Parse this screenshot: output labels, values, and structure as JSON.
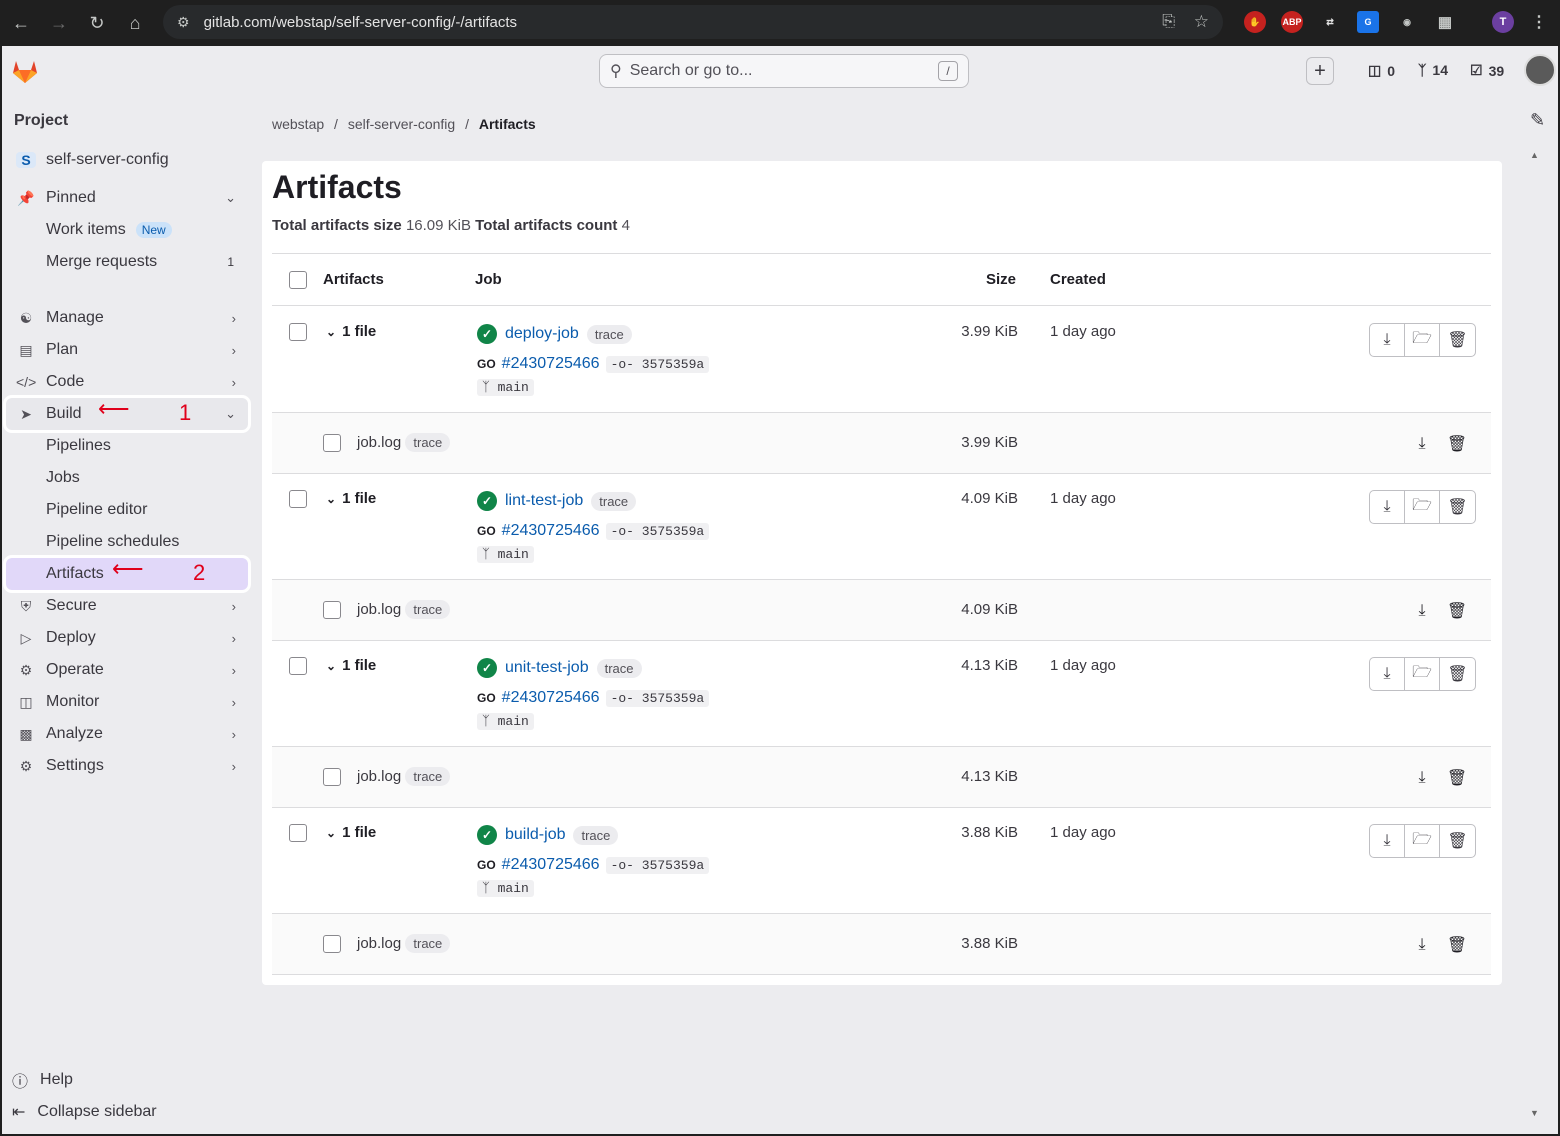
{
  "browser": {
    "url": "gitlab.com/webstap/self-server-config/-/artifacts",
    "profile_initial": "T",
    "ext_abp": "ABP"
  },
  "topbar": {
    "search_placeholder": "Search or go to...",
    "search_shortcut": "/",
    "issues_count": "0",
    "mr_count": "14",
    "todo_count": "39"
  },
  "sidebar": {
    "heading": "Project",
    "project_initial": "S",
    "project_name": "self-server-config",
    "pinned": "Pinned",
    "work_items": "Work items",
    "new_badge": "New",
    "merge_requests": "Merge requests",
    "merge_requests_count": "1",
    "manage": "Manage",
    "plan": "Plan",
    "code": "Code",
    "build": "Build",
    "pipelines": "Pipelines",
    "jobs": "Jobs",
    "pipeline_editor": "Pipeline editor",
    "pipeline_schedules": "Pipeline schedules",
    "artifacts": "Artifacts",
    "secure": "Secure",
    "deploy": "Deploy",
    "operate": "Operate",
    "monitor": "Monitor",
    "analyze": "Analyze",
    "settings": "Settings",
    "help": "Help",
    "collapse": "Collapse sidebar"
  },
  "annotations": {
    "step1": "1",
    "step2": "2"
  },
  "breadcrumb": [
    "webstap",
    "self-server-config",
    "Artifacts"
  ],
  "page": {
    "title": "Artifacts",
    "size_label": "Total artifacts size",
    "size_value": "16.09 KiB",
    "count_label": "Total artifacts count",
    "count_value": "4"
  },
  "table": {
    "headers": {
      "artifacts": "Artifacts",
      "job": "Job",
      "size": "Size",
      "created": "Created"
    },
    "rows": [
      {
        "files": "1 file",
        "job": "deploy-job",
        "tag": "trace",
        "pipeline": "#2430725466",
        "commit": "3575359a",
        "branch": "main",
        "size": "3.99 KiB",
        "created": "1 day ago",
        "file_name": "job.log",
        "file_tag": "trace",
        "file_size": "3.99 KiB"
      },
      {
        "files": "1 file",
        "job": "lint-test-job",
        "tag": "trace",
        "pipeline": "#2430725466",
        "commit": "3575359a",
        "branch": "main",
        "size": "4.09 KiB",
        "created": "1 day ago",
        "file_name": "job.log",
        "file_tag": "trace",
        "file_size": "4.09 KiB"
      },
      {
        "files": "1 file",
        "job": "unit-test-job",
        "tag": "trace",
        "pipeline": "#2430725466",
        "commit": "3575359a",
        "branch": "main",
        "size": "4.13 KiB",
        "created": "1 day ago",
        "file_name": "job.log",
        "file_tag": "trace",
        "file_size": "4.13 KiB"
      },
      {
        "files": "1 file",
        "job": "build-job",
        "tag": "trace",
        "pipeline": "#2430725466",
        "commit": "3575359a",
        "branch": "main",
        "size": "3.88 KiB",
        "created": "1 day ago",
        "file_name": "job.log",
        "file_tag": "trace",
        "file_size": "3.88 KiB"
      }
    ]
  },
  "colors": {
    "accent": "#0b5cad",
    "success": "#108548",
    "annotation": "#e0001b",
    "active_nav": "#e1d8f9"
  }
}
